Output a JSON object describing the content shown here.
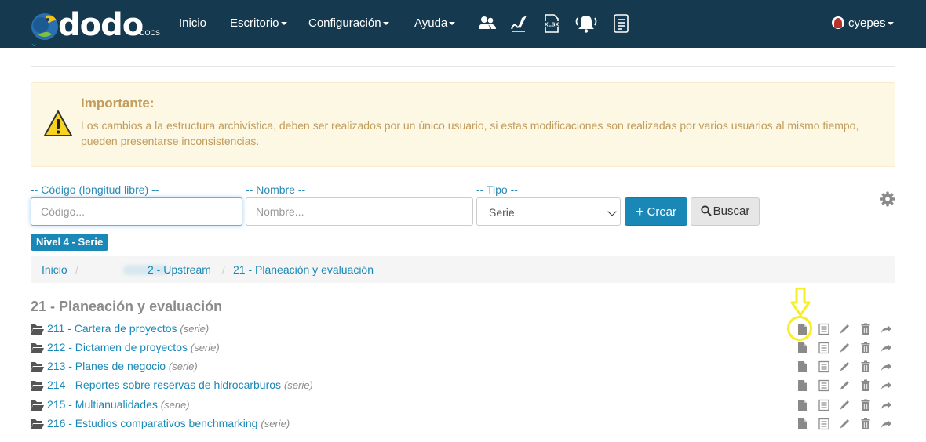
{
  "navbar": {
    "brand": "dodo",
    "brand_sub": "DOCS",
    "menu": [
      {
        "label": "Inicio",
        "dropdown": false
      },
      {
        "label": "Escritorio",
        "dropdown": true
      },
      {
        "label": "Configuración",
        "dropdown": true
      },
      {
        "label": "Ayuda",
        "dropdown": true
      }
    ],
    "icons": [
      "users-icon",
      "signature-icon",
      "xlsx-file-icon",
      "bell-icon",
      "checklist-icon"
    ],
    "xlsx_label": "XLSX",
    "user": "cyepes"
  },
  "alert": {
    "title": "Importante:",
    "body": "Los cambios a la estructura archivística, deben ser realizados por un único usuario, si estas modificaciones son realizadas por varios usuarios al mismo tiempo, pueden presentarse inconsistencias."
  },
  "form": {
    "codigo_label": "-- Código (longitud libre) --",
    "codigo_placeholder": "Código...",
    "nombre_label": "-- Nombre --",
    "nombre_placeholder": "Nombre...",
    "tipo_label": "-- Tipo --",
    "tipo_selected": "Serie",
    "crear_label": "Crear",
    "buscar_label": "Buscar"
  },
  "level_badge": "Nivel 4 - Serie",
  "breadcrumb": [
    "Inicio",
    "2 - Upstream",
    "21 - Planeación y evaluación"
  ],
  "section_title": "21 - Planeación y evaluación",
  "items": [
    {
      "name": "211 - Cartera de proyectos",
      "tag": "(serie)"
    },
    {
      "name": "212 - Dictamen de proyectos",
      "tag": "(serie)"
    },
    {
      "name": "213 - Planes de negocio",
      "tag": "(serie)"
    },
    {
      "name": "214 - Reportes sobre reservas de hidrocarburos",
      "tag": "(serie)"
    },
    {
      "name": "215 - Multianualidades",
      "tag": "(serie)"
    },
    {
      "name": "216 - Estudios comparativos benchmarking",
      "tag": "(serie)"
    }
  ],
  "row_actions": [
    "document-icon",
    "list-icon",
    "pencil-icon",
    "trash-icon",
    "share-arrow-icon"
  ],
  "colors": {
    "navbar_bg": "#153a4f",
    "accent": "#1a88b6",
    "alert_bg": "#fcf8e3",
    "alert_text": "#c29c5c",
    "highlight": "#f7ee2a"
  }
}
